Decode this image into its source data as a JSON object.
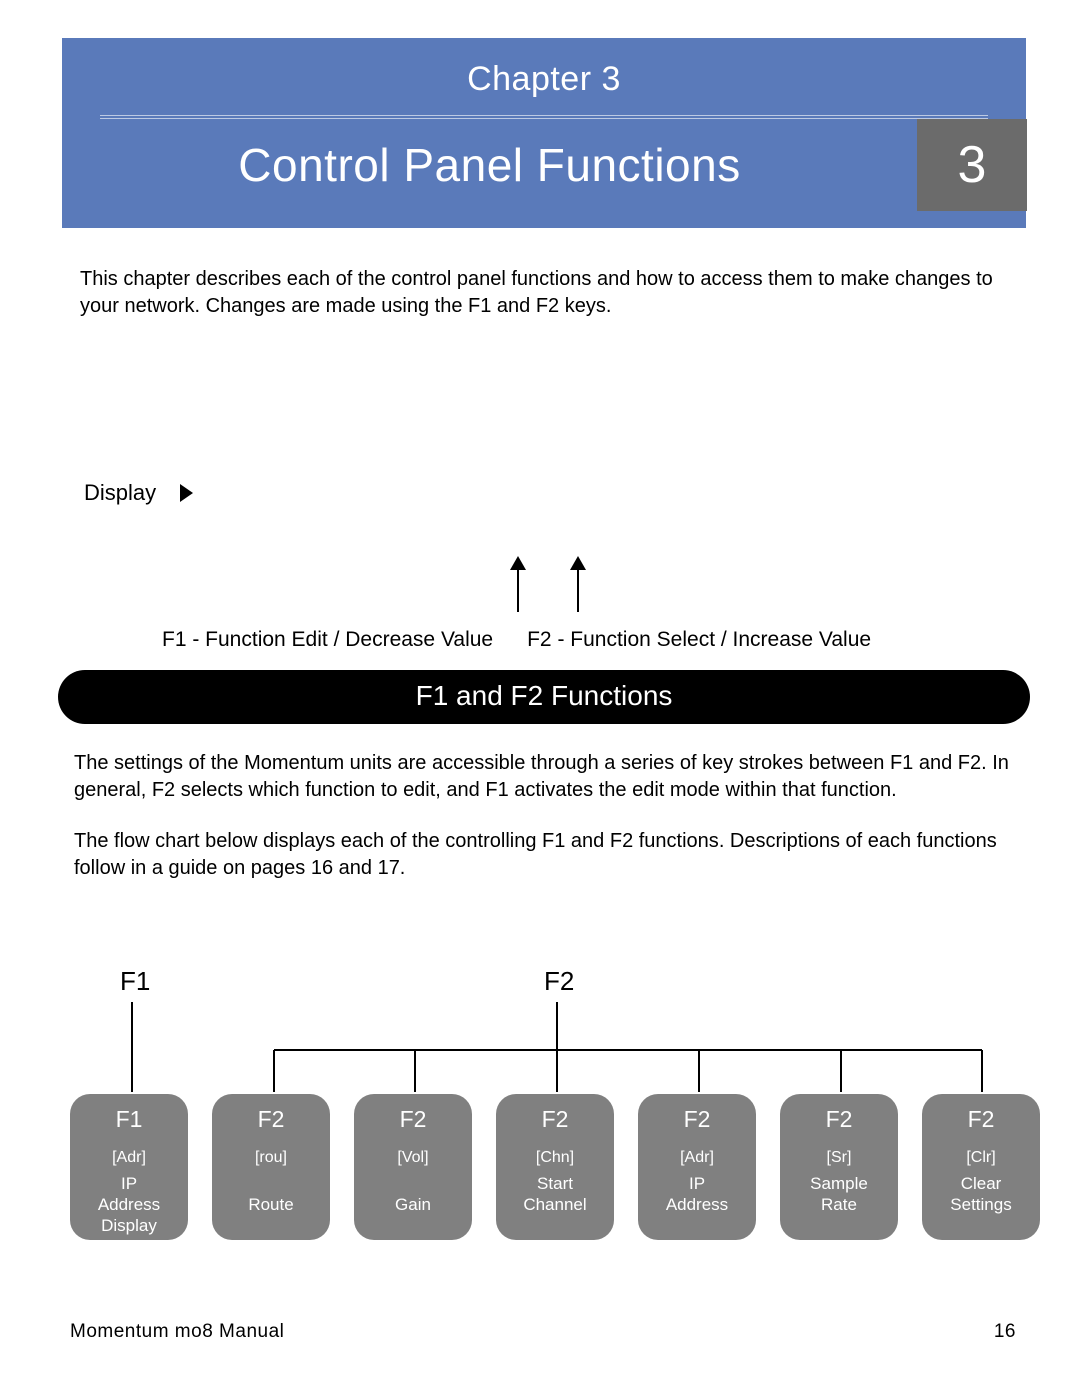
{
  "header": {
    "chapter_label": "Chapter 3",
    "title": "Control Panel Functions",
    "chapter_number": "3"
  },
  "intro": "This chapter describes each of the control panel functions and how to access them to make changes to your network. Changes are made using the F1 and F2 keys.",
  "display_label": "Display",
  "arrow_captions": {
    "f1": "F1 - Function Edit / Decrease Value",
    "f2": "F2 - Function Select / Increase Value"
  },
  "section_header": "F1 and F2 Functions",
  "para1": "The settings of the Momentum units are accessible through a series of key strokes between F1 and F2. In general, F2 selects which function to edit, and F1 activates the edit mode within that function.",
  "para2_a": "The flow chart below displays each of the controlling F1 and F2 ",
  "para2_b": "functions",
  "para2_c": ". Descriptions of each functions follow in a guide on pages 16 and 17.",
  "flow": {
    "top_f1": "F1",
    "top_f2": "F2",
    "boxes": [
      {
        "key": "F1",
        "code": "[Adr]",
        "desc": "IP\nAddress\nDisplay"
      },
      {
        "key": "F2",
        "code": "[rou]",
        "desc": "\nRoute"
      },
      {
        "key": "F2",
        "code": "[Vol]",
        "desc": "\nGain"
      },
      {
        "key": "F2",
        "code": "[Chn]",
        "desc": "Start\nChannel"
      },
      {
        "key": "F2",
        "code": "[Adr]",
        "desc": "IP\nAddress"
      },
      {
        "key": "F2",
        "code": "[Sr]",
        "desc": "Sample\nRate"
      },
      {
        "key": "F2",
        "code": "[Clr]",
        "desc": "Clear\nSettings"
      }
    ]
  },
  "footer": {
    "doc": "Momentum mo8 Manual",
    "page": "16"
  }
}
